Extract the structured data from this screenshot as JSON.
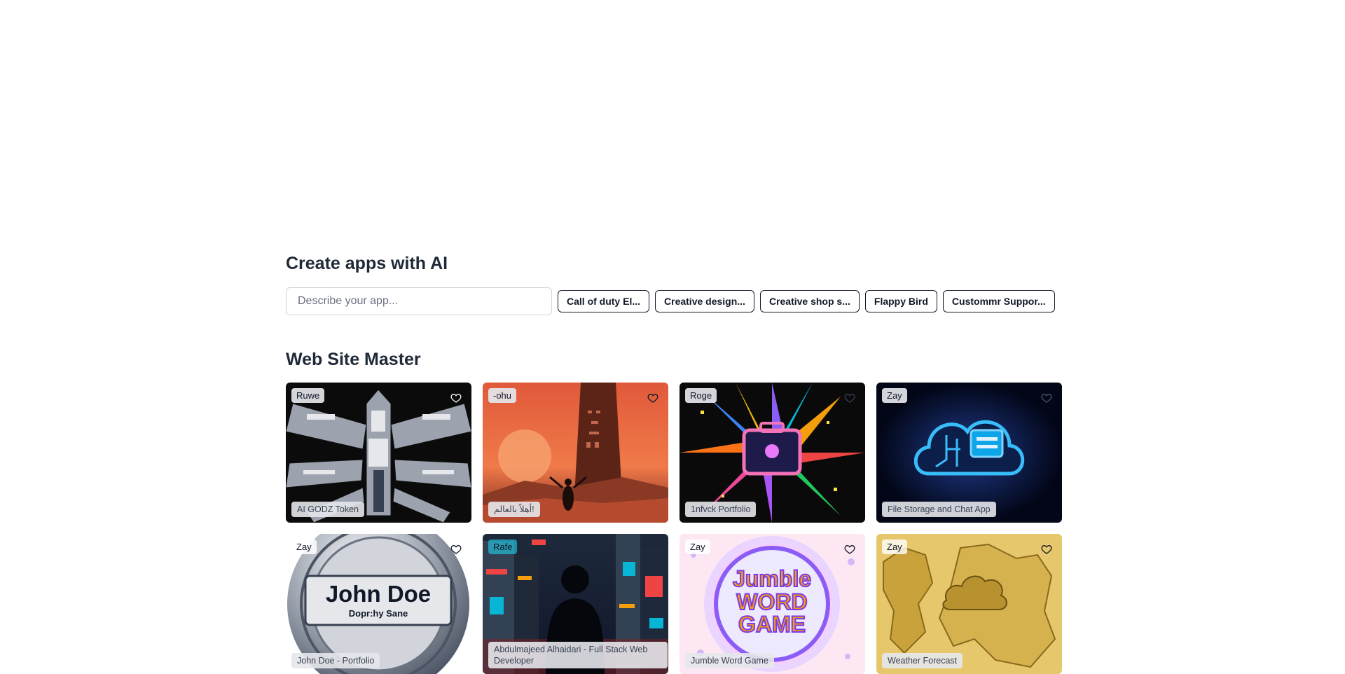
{
  "create": {
    "heading": "Create apps with AI",
    "placeholder": "Describe your app...",
    "suggestions": [
      "Call of duty El...",
      "Creative design...",
      "Creative shop s...",
      "Flappy Bird",
      "Custommr Suppor..."
    ]
  },
  "section": {
    "heading": "Web Site Master",
    "cards": [
      {
        "user": "Ruwe",
        "title": "AI GODZ Token",
        "icon": "heart-icon"
      },
      {
        "user": "-ohu",
        "title": "أهلاً بالعالم!",
        "icon": "heart-icon"
      },
      {
        "user": "Roge",
        "title": "1nfvck Portfolio",
        "icon": "heart-icon"
      },
      {
        "user": "Zay",
        "title": "File Storage and Chat App",
        "icon": "heart-icon"
      },
      {
        "user": "Zay",
        "title": "John Doe - Portfolio",
        "icon": "heart-icon",
        "art_text": "John Doe",
        "art_subtext": "Dopr:hy Sane"
      },
      {
        "user": "Rafe",
        "title": "Abdulmajeed Alhaidari - Full Stack Web Developer",
        "icon": "heart-icon"
      },
      {
        "user": "Zay",
        "title": "Jumble Word Game",
        "icon": "heart-icon",
        "art_text": [
          "Jumble",
          "WORD",
          "GAME"
        ]
      },
      {
        "user": "Zay",
        "title": "Weather Forecast",
        "icon": "heart-icon"
      }
    ]
  },
  "colors": {
    "heading": "#1f2937",
    "chip_border": "#111827",
    "input_border": "#d1d5db"
  }
}
